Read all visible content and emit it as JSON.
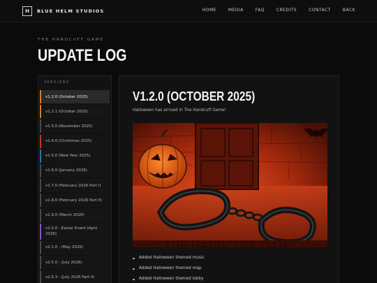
{
  "header": {
    "logo_letter": "H",
    "brand": "BLUE HELM STUDIOS",
    "nav": [
      "HOME",
      "MEDIA",
      "FAQ",
      "CREDITS",
      "CONTACT",
      "BACK"
    ]
  },
  "page": {
    "eyebrow": "THE HANDCUFF GAME",
    "title": "UPDATE LOG"
  },
  "sidebar": {
    "heading": "VERSIONS",
    "versions": [
      {
        "label": "v1.2.0 (October 2025)",
        "accent": "#e07a1f",
        "active": true
      },
      {
        "label": "v1.2.1 (October 2025)",
        "accent": "#e07a1f",
        "active": false
      },
      {
        "label": "v1.3.0 (November 2025)",
        "accent": "#4a4a4a",
        "active": false
      },
      {
        "label": "v1.4.0 (Christmas 2025)",
        "accent": "#c0392b",
        "active": false
      },
      {
        "label": "v1.5.0 (New Year 2025)",
        "accent": "#2f6fb0",
        "active": false
      },
      {
        "label": "v1.6.0 (January 2026)",
        "accent": "#4a4a4a",
        "active": false
      },
      {
        "label": "v1.7.0 (February 2026 Part I)",
        "accent": "#4a4a4a",
        "active": false
      },
      {
        "label": "v1.8.0 (February 2026 Part II)",
        "accent": "#4a4a4a",
        "active": false
      },
      {
        "label": "v1.9.0 (March 2026)",
        "accent": "#4a4a4a",
        "active": false
      },
      {
        "label": "v2.0.0 - Easter Event (April 2026)",
        "accent": "#7a5ab8",
        "active": false
      },
      {
        "label": "v2.1.0 - (May 2026)",
        "accent": "#4a4a4a",
        "active": false
      },
      {
        "label": "v2.5.0 - (July 2026)",
        "accent": "#4a4a4a",
        "active": false
      },
      {
        "label": "v2.6.3 - (July 2026 Part II)",
        "accent": "#4a4a4a",
        "active": false
      }
    ]
  },
  "release": {
    "title": "V1.2.0 (OCTOBER 2025)",
    "description": "Halloween has arrived in The Handcuff Game!",
    "image_caption": "THE HANDCUFF GAME",
    "features": [
      "Added Halloween themed music",
      "Added Halloween themed map",
      "Added Halloween themed lobby"
    ]
  }
}
